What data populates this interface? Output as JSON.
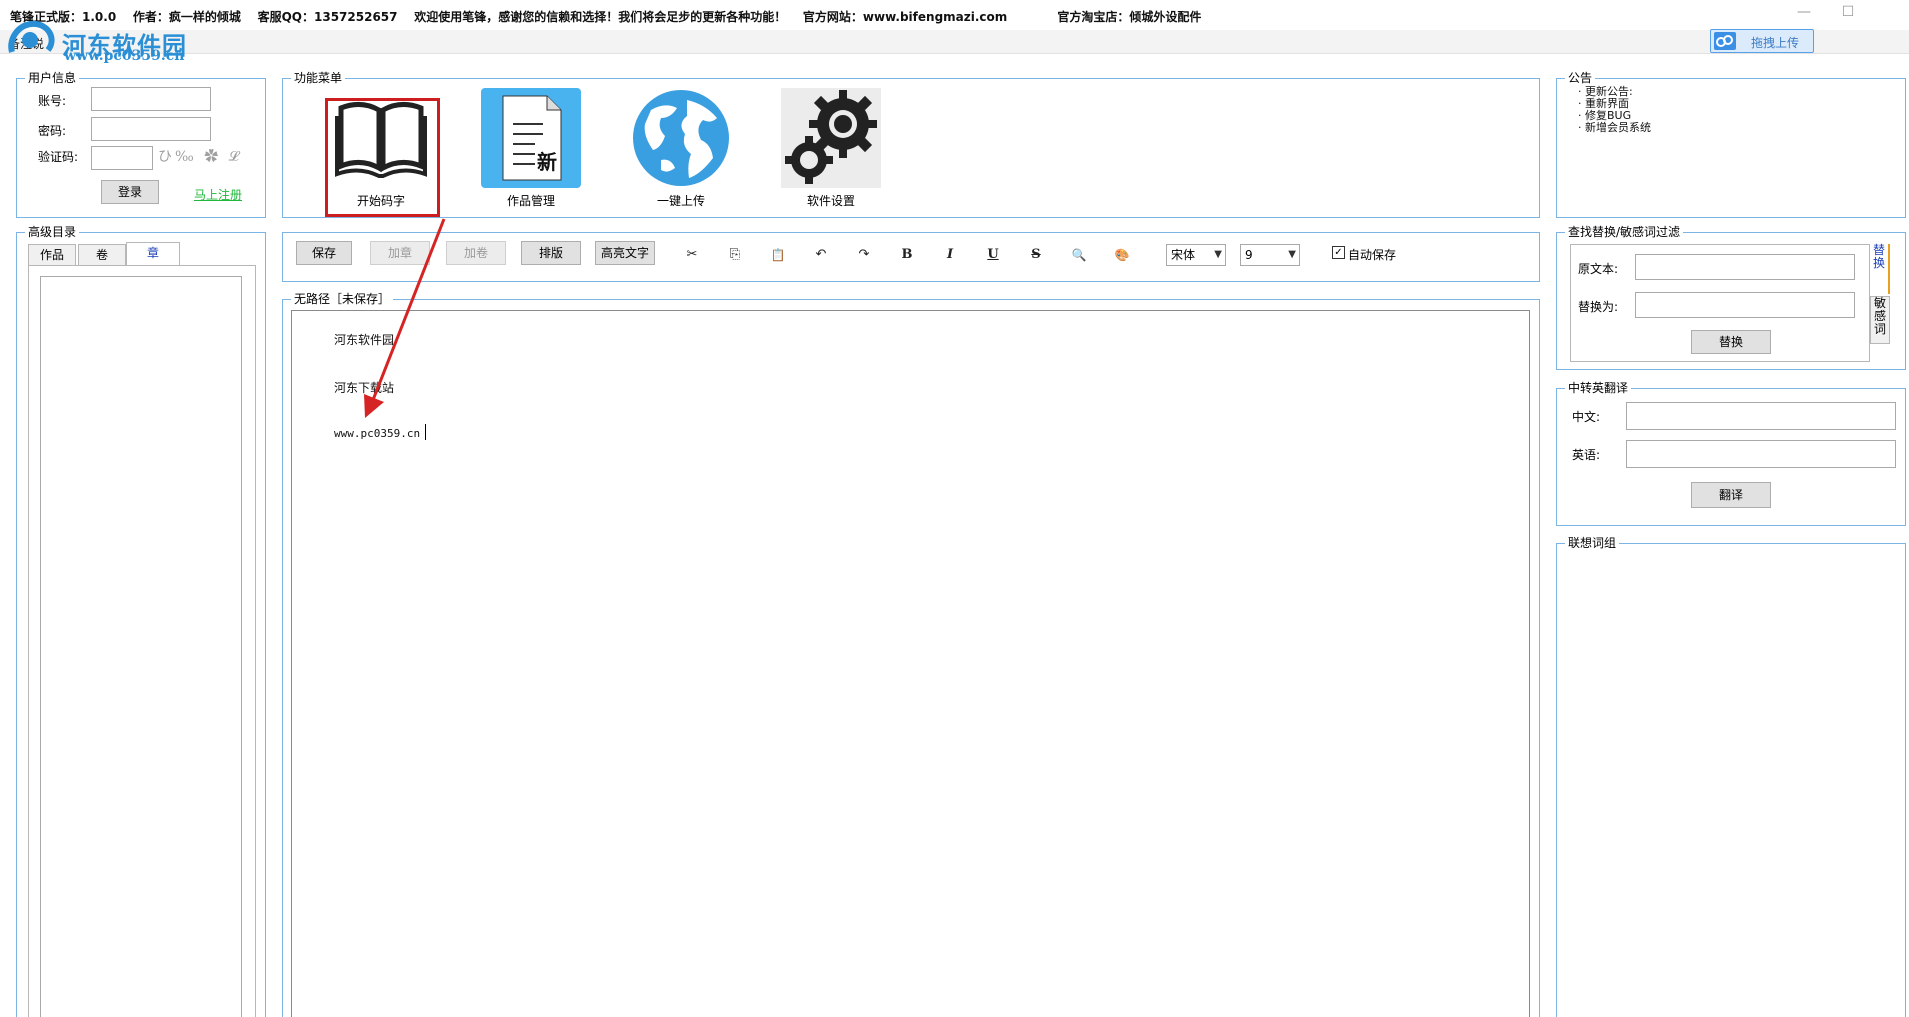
{
  "title_bar": {
    "text": "笔锋正式版：1.0.0    作者：疯一样的倾城    客服QQ：1357252657    欢迎使用笔锋，感谢您的信赖和选择！我们将会足步的更新各种功能！    官方网站：www.bifengmazi.com            官方淘宝店：倾城外设配件",
    "minimize": "—",
    "maximize": "☐"
  },
  "menu": {
    "item": "备注说"
  },
  "watermark": {
    "text": "河东软件园",
    "url": "www.pc0359.cn"
  },
  "cloud_upload": {
    "label": "拖拽上传"
  },
  "user_info": {
    "title": "用户信息",
    "account_label": "账号:",
    "password_label": "密码:",
    "captcha_label": "验证码:",
    "captcha_image_text": "ひ‰ ✿ 𝓛",
    "login_button": "登录",
    "register_link": "马上注册"
  },
  "function_menu": {
    "title": "功能菜单",
    "items": [
      {
        "label": "开始码字",
        "icon": "book-icon"
      },
      {
        "label": "作品管理",
        "icon": "document-new-icon"
      },
      {
        "label": "一键上传",
        "icon": "globe-icon"
      },
      {
        "label": "软件设置",
        "icon": "gears-icon"
      }
    ],
    "doc_icon_char": "新"
  },
  "notice": {
    "title": "公告",
    "items": [
      "· 更新公告:",
      "· 重新界面",
      "· 修复BUG",
      "· 新增会员系统"
    ]
  },
  "catalog": {
    "title": "高级目录",
    "tabs": [
      "作品",
      "卷",
      "章"
    ]
  },
  "toolbar": {
    "save": "保存",
    "add_chapter": "加章",
    "add_volume": "加卷",
    "format": "排版",
    "highlight": "高亮文字",
    "icons": [
      "cut-icon",
      "copy-icon",
      "paste-icon",
      "undo-icon",
      "redo-icon",
      "bold-icon",
      "italic-icon",
      "underline-icon",
      "strikethrough-icon",
      "find-icon",
      "paint-icon"
    ],
    "icon_glyphs": [
      "✂",
      "⎘",
      "📋",
      "↶",
      "↷",
      "B",
      "I",
      "U",
      "S",
      "🔍",
      "🎨"
    ],
    "font_value": "宋体",
    "size_value": "9",
    "autosave_label": "自动保存",
    "autosave_checked": "✓"
  },
  "editor": {
    "title": "无路径［未保存］",
    "lines": [
      "河东软件园",
      "河东下载站",
      "www.pc0359.cn"
    ]
  },
  "replace_panel": {
    "title": "查找替换/敏感词过滤",
    "original_label": "原文本:",
    "replace_label": "替换为:",
    "replace_button": "替换",
    "tab_replace": "替换",
    "tab_sensitive": "敏感词"
  },
  "translate_panel": {
    "title": "中转英翻译",
    "chinese_label": "中文:",
    "english_label": "英语:",
    "translate_button": "翻译"
  },
  "word_group": {
    "title": "联想词组"
  }
}
